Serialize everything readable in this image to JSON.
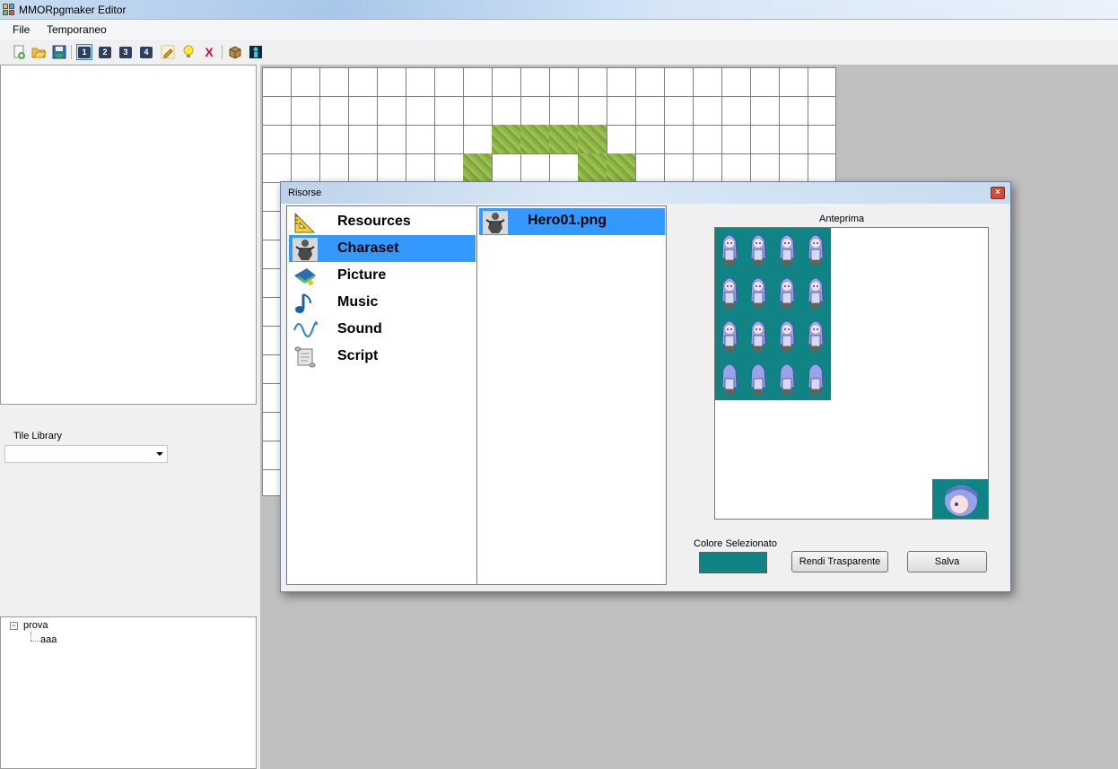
{
  "window": {
    "title": "MMORpgmaker Editor"
  },
  "menu": {
    "items": [
      "File",
      "Temporaneo"
    ]
  },
  "toolbar": {
    "buttons": [
      "new-icon",
      "open-icon",
      "save-icon",
      "layer-1",
      "layer-2",
      "layer-3",
      "layer-4",
      "pencil-icon",
      "lightbulb-icon",
      "delete-icon",
      "box-icon",
      "character-icon"
    ],
    "layer_labels": [
      "1",
      "2",
      "3",
      "4"
    ],
    "delete_label": "X"
  },
  "left": {
    "tile_library_label": "Tile Library",
    "tile_library_value": "",
    "tree": {
      "root": "prova",
      "children": [
        "aaa"
      ]
    }
  },
  "dialog": {
    "title": "Risorse",
    "categories": [
      {
        "label": "Resources",
        "icon": "triangle-ruler-icon"
      },
      {
        "label": "Charaset",
        "icon": "character-icon",
        "selected": true
      },
      {
        "label": "Picture",
        "icon": "picture-icon"
      },
      {
        "label": "Music",
        "icon": "music-note-icon"
      },
      {
        "label": "Sound",
        "icon": "sound-wave-icon"
      },
      {
        "label": "Script",
        "icon": "scroll-icon"
      }
    ],
    "files": [
      {
        "label": "Hero01.png",
        "selected": true
      }
    ],
    "preview_label": "Anteprima",
    "selected_color_label": "Colore Selezionato",
    "selected_color": "#108484",
    "transparent_button": "Rendi Trasparente",
    "save_button": "Salva"
  },
  "colors": {
    "selection": "#3399ff",
    "sprite_bg": "#108484",
    "map_bg": "#c0c0c0"
  }
}
